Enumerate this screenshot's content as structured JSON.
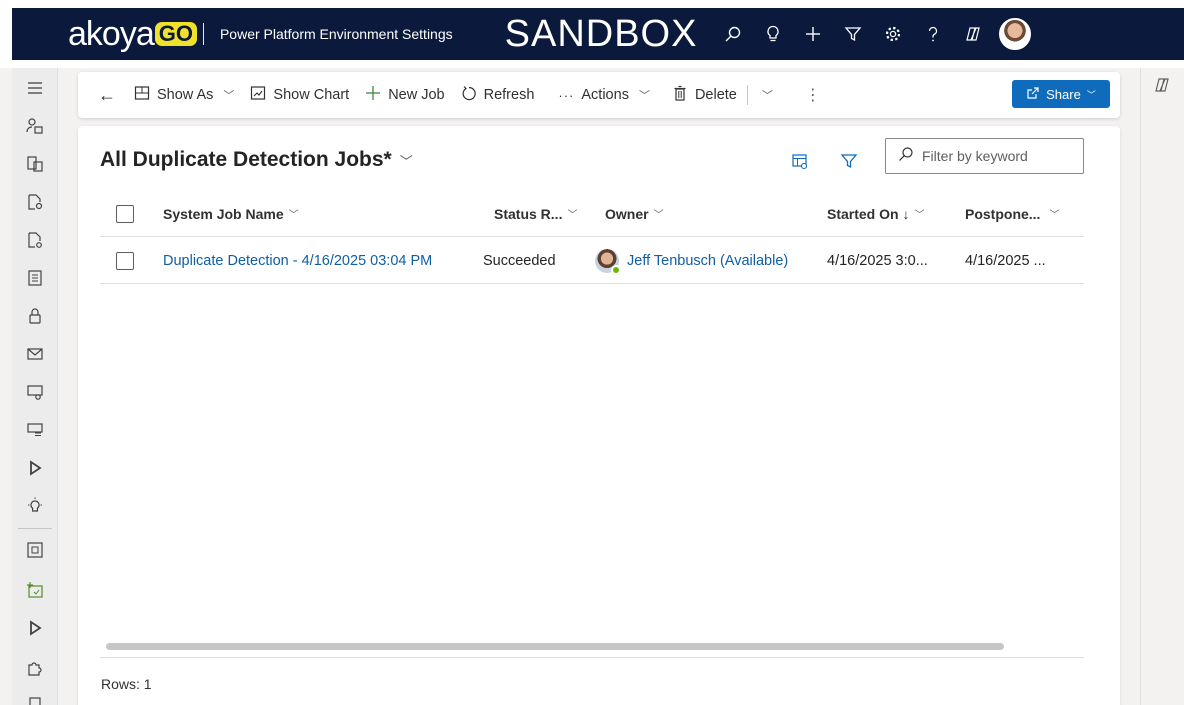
{
  "header": {
    "brand_main": "akoya",
    "brand_accent": "GO",
    "app_title": "Power Platform Environment Settings",
    "environment": "SANDBOX",
    "icons": [
      "search-icon",
      "lightbulb-icon",
      "plus-icon",
      "filter-icon",
      "gear-icon",
      "help-icon",
      "copilot-icon"
    ],
    "colors": {
      "bar": "#0b1a3c",
      "accent": "#f2e12a"
    }
  },
  "leftnav": {
    "icons": [
      "menu-icon",
      "user-lock-icon",
      "entity-icon",
      "document-settings-icon",
      "file-settings-icon",
      "list-icon",
      "lock-icon",
      "mail-icon",
      "screen-settings-icon",
      "monitor-list-icon",
      "play-icon",
      "lightbulb-icon",
      "puzzle-frame-icon",
      "table-plus-icon",
      "play-icon",
      "puzzle-icon",
      "box-icon"
    ]
  },
  "commandbar": {
    "back_label": "←",
    "show_as": "Show As",
    "show_chart": "Show Chart",
    "new_job": "New Job",
    "refresh": "Refresh",
    "actions": "Actions",
    "delete": "Delete",
    "more": "⋮",
    "share": "Share",
    "colors": {
      "primary": "#0f6cbd"
    }
  },
  "view": {
    "title": "All Duplicate Detection Jobs*",
    "filter_placeholder": "Filter by keyword"
  },
  "grid": {
    "columns": [
      "System Job Name",
      "Status R...",
      "Owner",
      "Started On ↓",
      "Postpone..."
    ],
    "rows": [
      {
        "name": "Duplicate Detection - 4/16/2025 03:04 PM",
        "status": "Succeeded",
        "owner": "Jeff Tenbusch (Available)",
        "started_on": "4/16/2025 3:0...",
        "postponed": "4/16/2025 ..."
      }
    ]
  },
  "footer": {
    "rows_label": "Rows: 1"
  }
}
